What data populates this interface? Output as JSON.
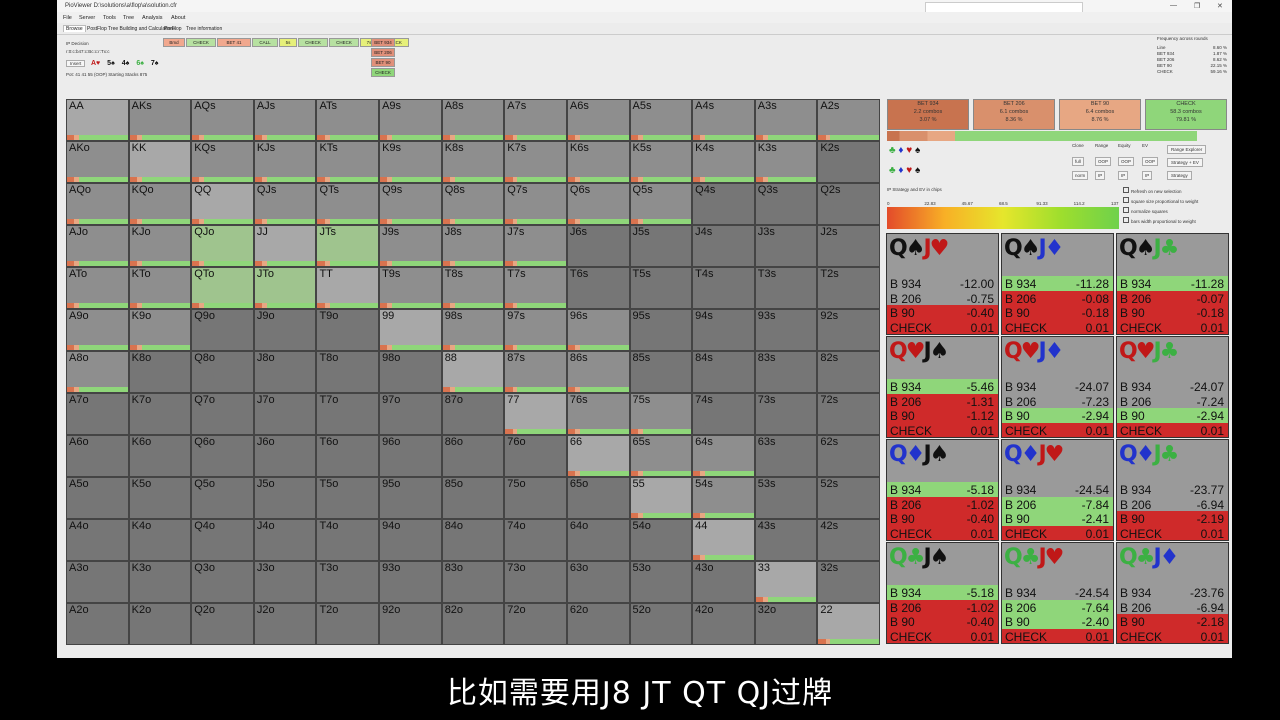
{
  "window": {
    "title": "PioViewer   D:\\solutions\\a\\flop\\a\\solution.cfr",
    "controls": [
      "—",
      "❐",
      "✕"
    ]
  },
  "menu": [
    "File",
    "Server",
    "Tools",
    "Tree",
    "Analysis",
    "About"
  ],
  "tabs": [
    "Browse",
    "PostFlop Tree Building and Calculations",
    "PreFlop",
    "Tree information"
  ],
  "info": {
    "line1": "IP Decision",
    "line2": "r:0:c:b47:c:Bc:c:r:Tx:c",
    "insert_label": "Insert",
    "board": [
      "A♥",
      "5♠",
      "4♠",
      "6♠",
      "7♠"
    ],
    "pot_line": "Pot: 41 41 55 (OOP) Starting Stacks 875"
  },
  "action_buttons": [
    {
      "label": "Bmd",
      "color": "#f1a88e"
    },
    {
      "label": "CHECK",
      "color": "#b7e1a1"
    },
    {
      "label": "BET 41",
      "color": "#f1a88e"
    },
    {
      "label": "CALL",
      "color": "#b7e1a1"
    },
    {
      "label": "5s",
      "color": "#e6f07a"
    },
    {
      "label": "CHECK",
      "color": "#b7e1a1"
    },
    {
      "label": "CHECK",
      "color": "#b7e1a1"
    },
    {
      "label": "7s",
      "color": "#e6f07a"
    },
    {
      "label": "CHECK",
      "color": "#e6f07a"
    }
  ],
  "bet_stack": [
    "BET 934",
    "BET 206",
    "BET 90",
    "CHECK"
  ],
  "freq_panel": {
    "title": "Frequency across rounds",
    "rows": [
      [
        "Line",
        "8.60 %"
      ],
      [
        "BET 934",
        "1.87 %"
      ],
      [
        "BET 206",
        "8.62 %"
      ],
      [
        "BET 90",
        "22.15 %"
      ],
      [
        "CHECK",
        "59.16 %"
      ]
    ]
  },
  "strategy": [
    {
      "action": "BET 934",
      "combos": "2.2 combos",
      "pct": "3.07 %",
      "color": "#c8734f"
    },
    {
      "action": "BET 206",
      "combos": "6.1 combos",
      "pct": "8.36 %",
      "color": "#d9906c"
    },
    {
      "action": "BET 90",
      "combos": "6.4 combos",
      "pct": "8.76 %",
      "color": "#e7a783"
    },
    {
      "action": "CHECK",
      "combos": "58.3 combos",
      "pct": "79.81 %",
      "color": "#8fd67a"
    }
  ],
  "options": {
    "buttons": [
      "Clone",
      "Range",
      "Equity",
      "EV",
      "full",
      "OOP",
      "OOP",
      "OOP",
      "norm",
      "IP",
      "IP",
      "IP"
    ],
    "range_explorer": "Range Explorer",
    "strategy_ev": "Strategy + EV",
    "strategy": "Strategy",
    "checks": [
      "Refresh on new selection",
      "square size proportional to weight",
      "normalize squares",
      "bars width proportional to weight"
    ],
    "ev_label": "IP Strategy and EV in chips"
  },
  "scale": [
    "0",
    "22.83",
    "45.67",
    "68.5",
    "91.33",
    "114.2",
    "137"
  ],
  "grid": {
    "labels": [
      [
        "AA",
        "AKs",
        "AQs",
        "AJs",
        "ATs",
        "A9s",
        "A8s",
        "A7s",
        "A6s",
        "A5s",
        "A4s",
        "A3s",
        "A2s"
      ],
      [
        "AKo",
        "KK",
        "KQs",
        "KJs",
        "KTs",
        "K9s",
        "K8s",
        "K7s",
        "K6s",
        "K5s",
        "K4s",
        "K3s",
        "K2s"
      ],
      [
        "AQo",
        "KQo",
        "QQ",
        "QJs",
        "QTs",
        "Q9s",
        "Q8s",
        "Q7s",
        "Q6s",
        "Q5s",
        "Q4s",
        "Q3s",
        "Q2s"
      ],
      [
        "AJo",
        "KJo",
        "QJo",
        "JJ",
        "JTs",
        "J9s",
        "J8s",
        "J7s",
        "J6s",
        "J5s",
        "J4s",
        "J3s",
        "J2s"
      ],
      [
        "ATo",
        "KTo",
        "QTo",
        "JTo",
        "TT",
        "T9s",
        "T8s",
        "T7s",
        "T6s",
        "T5s",
        "T4s",
        "T3s",
        "T2s"
      ],
      [
        "A9o",
        "K9o",
        "Q9o",
        "J9o",
        "T9o",
        "99",
        "98s",
        "97s",
        "96s",
        "95s",
        "94s",
        "93s",
        "92s"
      ],
      [
        "A8o",
        "K8o",
        "Q8o",
        "J8o",
        "T8o",
        "98o",
        "88",
        "87s",
        "86s",
        "85s",
        "84s",
        "83s",
        "82s"
      ],
      [
        "A7o",
        "K7o",
        "Q7o",
        "J7o",
        "T7o",
        "97o",
        "87o",
        "77",
        "76s",
        "75s",
        "74s",
        "73s",
        "72s"
      ],
      [
        "A6o",
        "K6o",
        "Q6o",
        "J6o",
        "T6o",
        "96o",
        "86o",
        "76o",
        "66",
        "65s",
        "64s",
        "63s",
        "62s"
      ],
      [
        "A5o",
        "K5o",
        "Q5o",
        "J5o",
        "T5o",
        "95o",
        "85o",
        "75o",
        "65o",
        "55",
        "54s",
        "53s",
        "52s"
      ],
      [
        "A4o",
        "K4o",
        "Q4o",
        "J4o",
        "T4o",
        "94o",
        "84o",
        "74o",
        "64o",
        "54o",
        "44",
        "43s",
        "42s"
      ],
      [
        "A3o",
        "K3o",
        "Q3o",
        "J3o",
        "T3o",
        "93o",
        "83o",
        "73o",
        "63o",
        "53o",
        "43o",
        "33",
        "32s"
      ],
      [
        "A2o",
        "K2o",
        "Q2o",
        "J2o",
        "T2o",
        "92o",
        "82o",
        "72o",
        "62o",
        "52o",
        "42o",
        "32o",
        "22"
      ]
    ],
    "active": [
      "AA",
      "AKs",
      "AQs",
      "AJs",
      "ATs",
      "A9s",
      "A8s",
      "A7s",
      "A6s",
      "A5s",
      "A4s",
      "A3s",
      "A2s",
      "AKo",
      "KK",
      "KQs",
      "KJs",
      "KTs",
      "K9s",
      "K8s",
      "K7s",
      "K6s",
      "K5s",
      "K4s",
      "K3s",
      "AQo",
      "KQo",
      "QQ",
      "QJs",
      "QTs",
      "Q9s",
      "Q8s",
      "Q7s",
      "Q6s",
      "Q5s",
      "AJo",
      "KJo",
      "QJo",
      "JJ",
      "JTs",
      "J9s",
      "J8s",
      "J7s",
      "ATo",
      "KTo",
      "QTo",
      "JTo",
      "TT",
      "T9s",
      "T8s",
      "T7s",
      "A9o",
      "K9o",
      "99",
      "98s",
      "97s",
      "96s",
      "A8o",
      "88",
      "87s",
      "86s",
      "77",
      "76s",
      "75s",
      "66",
      "65s",
      "64s",
      "55",
      "54s",
      "44",
      "33",
      "22"
    ],
    "highlight": [
      "QJo",
      "QTo",
      "JTo",
      "JJ",
      "JTs"
    ]
  },
  "combos": [
    {
      "hand": "Q♠J♥",
      "colors": [
        "#111",
        "#111",
        "#c01818",
        "#c01818"
      ],
      "rows": [
        [
          "B 934",
          "-12.00",
          "#9a9a9a"
        ],
        [
          "B 206",
          "-0.75",
          "#9a9a9a"
        ],
        [
          "B 90",
          "-0.40",
          "#cf2a2a"
        ],
        [
          "CHECK",
          "0.01",
          "#cf2a2a"
        ]
      ]
    },
    {
      "hand": "Q♠J♦",
      "colors": [
        "#111",
        "#111",
        "#2233cc",
        "#2233cc"
      ],
      "rows": [
        [
          "B 934",
          "-11.28",
          "#8fd67a"
        ],
        [
          "B 206",
          "-0.08",
          "#cf2a2a"
        ],
        [
          "B 90",
          "-0.18",
          "#cf2a2a"
        ],
        [
          "CHECK",
          "0.01",
          "#cf2a2a"
        ]
      ]
    },
    {
      "hand": "Q♠J♣",
      "colors": [
        "#111",
        "#111",
        "#3cb043",
        "#3cb043"
      ],
      "rows": [
        [
          "B 934",
          "-11.28",
          "#8fd67a"
        ],
        [
          "B 206",
          "-0.07",
          "#cf2a2a"
        ],
        [
          "B 90",
          "-0.18",
          "#cf2a2a"
        ],
        [
          "CHECK",
          "0.01",
          "#cf2a2a"
        ]
      ]
    },
    {
      "hand": "Q♥J♠",
      "colors": [
        "#c01818",
        "#c01818",
        "#111",
        "#111"
      ],
      "rows": [
        [
          "B 934",
          "-5.46",
          "#8fd67a"
        ],
        [
          "B 206",
          "-1.31",
          "#cf2a2a"
        ],
        [
          "B 90",
          "-1.12",
          "#cf2a2a"
        ],
        [
          "CHECK",
          "0.01",
          "#cf2a2a"
        ]
      ]
    },
    {
      "hand": "Q♥J♦",
      "colors": [
        "#c01818",
        "#c01818",
        "#2233cc",
        "#2233cc"
      ],
      "rows": [
        [
          "B 934",
          "-24.07",
          "#9a9a9a"
        ],
        [
          "B 206",
          "-7.23",
          "#9a9a9a"
        ],
        [
          "B 90",
          "-2.94",
          "#8fd67a"
        ],
        [
          "CHECK",
          "0.01",
          "#cf2a2a"
        ]
      ]
    },
    {
      "hand": "Q♥J♣",
      "colors": [
        "#c01818",
        "#c01818",
        "#3cb043",
        "#3cb043"
      ],
      "rows": [
        [
          "B 934",
          "-24.07",
          "#9a9a9a"
        ],
        [
          "B 206",
          "-7.24",
          "#9a9a9a"
        ],
        [
          "B 90",
          "-2.94",
          "#8fd67a"
        ],
        [
          "CHECK",
          "0.01",
          "#cf2a2a"
        ]
      ]
    },
    {
      "hand": "Q♦J♠",
      "colors": [
        "#2233cc",
        "#2233cc",
        "#111",
        "#111"
      ],
      "rows": [
        [
          "B 934",
          "-5.18",
          "#8fd67a"
        ],
        [
          "B 206",
          "-1.02",
          "#cf2a2a"
        ],
        [
          "B 90",
          "-0.40",
          "#cf2a2a"
        ],
        [
          "CHECK",
          "0.01",
          "#cf2a2a"
        ]
      ]
    },
    {
      "hand": "Q♦J♥",
      "colors": [
        "#2233cc",
        "#2233cc",
        "#c01818",
        "#c01818"
      ],
      "rows": [
        [
          "B 934",
          "-24.54",
          "#9a9a9a"
        ],
        [
          "B 206",
          "-7.84",
          "#8fd67a"
        ],
        [
          "B 90",
          "-2.41",
          "#8fd67a"
        ],
        [
          "CHECK",
          "0.01",
          "#cf2a2a"
        ]
      ]
    },
    {
      "hand": "Q♦J♣",
      "colors": [
        "#2233cc",
        "#2233cc",
        "#3cb043",
        "#3cb043"
      ],
      "rows": [
        [
          "B 934",
          "-23.77",
          "#9a9a9a"
        ],
        [
          "B 206",
          "-6.94",
          "#9a9a9a"
        ],
        [
          "B 90",
          "-2.19",
          "#cf2a2a"
        ],
        [
          "CHECK",
          "0.01",
          "#cf2a2a"
        ]
      ]
    },
    {
      "hand": "Q♣J♠",
      "colors": [
        "#3cb043",
        "#3cb043",
        "#111",
        "#111"
      ],
      "rows": [
        [
          "B 934",
          "-5.18",
          "#8fd67a"
        ],
        [
          "B 206",
          "-1.02",
          "#cf2a2a"
        ],
        [
          "B 90",
          "-0.40",
          "#cf2a2a"
        ],
        [
          "CHECK",
          "0.01",
          "#cf2a2a"
        ]
      ]
    },
    {
      "hand": "Q♣J♥",
      "colors": [
        "#3cb043",
        "#3cb043",
        "#c01818",
        "#c01818"
      ],
      "rows": [
        [
          "B 934",
          "-24.54",
          "#9a9a9a"
        ],
        [
          "B 206",
          "-7.64",
          "#8fd67a"
        ],
        [
          "B 90",
          "-2.40",
          "#8fd67a"
        ],
        [
          "CHECK",
          "0.01",
          "#cf2a2a"
        ]
      ]
    },
    {
      "hand": "Q♣J♦",
      "colors": [
        "#3cb043",
        "#3cb043",
        "#2233cc",
        "#2233cc"
      ],
      "rows": [
        [
          "B 934",
          "-23.76",
          "#9a9a9a"
        ],
        [
          "B 206",
          "-6.94",
          "#9a9a9a"
        ],
        [
          "B 90",
          "-2.18",
          "#cf2a2a"
        ],
        [
          "CHECK",
          "0.01",
          "#cf2a2a"
        ]
      ]
    }
  ],
  "subtitle": "比如需要用J8 JT QT QJ过牌"
}
